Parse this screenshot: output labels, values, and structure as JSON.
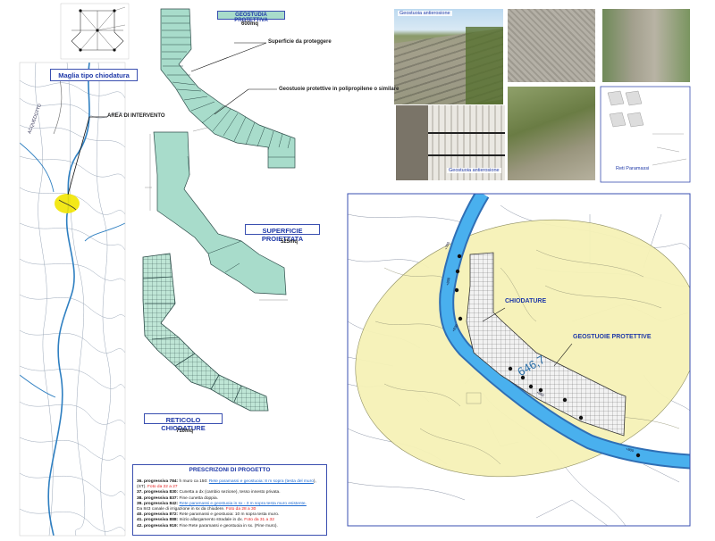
{
  "labels": {
    "maglia": "Maglia tipo chiodatura",
    "area": "AREA DI INTERVENTO",
    "geostudia_title": "GEOSTUDIA PROTETTIVA",
    "geostudia_area": "600mq",
    "superficie_proteggere": "Superficie da proteggere",
    "geostuoie_desc": "Geostuoie protettive in polipropilene o similare",
    "superficie_proiettata": "SUPERFICIE  PROIETTATA",
    "superficie_proiettata_area": "525mq",
    "reticolo": "RETICOLO  CHIODATURE",
    "reticolo_area": "710mq",
    "chiodature": "CHIODATURE",
    "geostuoie_protettive": "GEOSTUOIE PROTETTIVE",
    "map_number": "646,7",
    "map_side_label": "ACQUEDOTTO"
  },
  "photos": {
    "p1": "Geostuoia antierosione",
    "p2": "Geostuoia antierosione",
    "p3": "Reti Paramassi"
  },
  "prescrizioni": {
    "title": "PRESCRIZONI DI PROGETTO",
    "rows": [
      {
        "num": "36. progressiva 784:",
        "text": " h muro ca 150: ",
        "link": "Rete paramassi e geostuoia: 8 m sopra (testa del muro",
        "tail": "), (ST). ",
        "red": "Foto da 22 a 27"
      },
      {
        "num": "37. progressiva 830:",
        "text": " Cunetta a dx (cambio sezione), tesso innesto privata.",
        "link": "",
        "tail": "",
        "red": ""
      },
      {
        "num": "38. progressiva 837:",
        "text": " Fine cunetta doppia.",
        "link": "",
        "tail": "",
        "red": ""
      },
      {
        "num": "39. progressiva 842:",
        "text": " ",
        "link": "Rete paramassi e geostuoia in sx - 3 m sopra testa muro esistente.",
        "tail": "",
        "red": ""
      },
      {
        "num": "",
        "text": "Da 843 canale di irrigazione in sx da chiudere. ",
        "link": "",
        "tail": "",
        "red": "Foto da 28 a 30"
      },
      {
        "num": "40. progressiva 872:",
        "text": " Rete paramassi e geostuoia: 10 m sopra testa muro.",
        "link": "",
        "tail": "",
        "red": ""
      },
      {
        "num": "41. progressiva 888:",
        "text": " Inizio allargamento stradale in dx. ",
        "link": "",
        "tail": "",
        "red": "Foto da 31 a 32"
      },
      {
        "num": "42. progressiva 919:",
        "text": " Fine Rete paramassi e geostuoia in sx. (Fine muro).",
        "link": "",
        "tail": "",
        "red": ""
      }
    ]
  },
  "colors": {
    "accent": "#1f39a8",
    "mint": "#a8dccb",
    "road": "#3aa0e8",
    "ellipse": "#f7f3b8",
    "red": "#e21c1c"
  }
}
